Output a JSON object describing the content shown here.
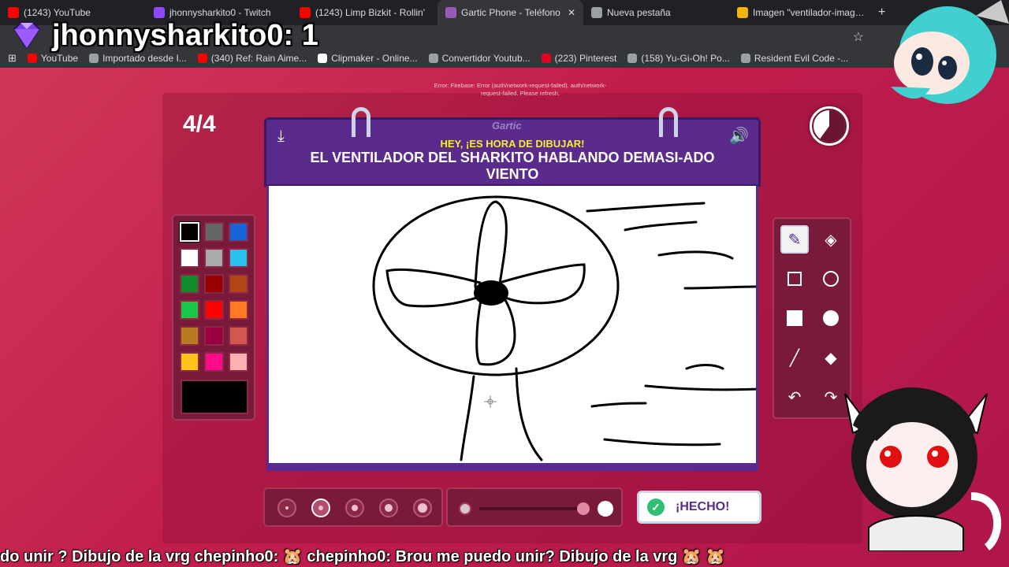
{
  "browser": {
    "tabs": [
      {
        "title": "(1243) YouTube",
        "favicon_color": "#ff0000",
        "active": false
      },
      {
        "title": "jhonnysharkito0 - Twitch",
        "favicon_color": "#9146ff",
        "active": false
      },
      {
        "title": "(1243) Limp Bizkit - Rollin'",
        "favicon_color": "#ff0000",
        "active": false
      },
      {
        "title": "Gartic Phone - Teléfono",
        "favicon_color": "#9b59b6",
        "active": true
      },
      {
        "title": "Nueva pestaña",
        "favicon_color": "#9aa0a6",
        "active": false
      },
      {
        "title": "Imagen \"ventilador-imagen-a",
        "favicon_color": "#f4b400",
        "active": false
      }
    ],
    "new_tab_label": "+",
    "close_label": "✕",
    "bookmarks": [
      {
        "label": "YouTube",
        "favicon_color": "#ff0000"
      },
      {
        "label": "Importado desde I...",
        "favicon_color": "#9aa0a6"
      },
      {
        "label": "(340) Ref: Rain Aime...",
        "favicon_color": "#ff0000"
      },
      {
        "label": "Clipmaker - Online...",
        "favicon_color": "#ffffff"
      },
      {
        "label": "Convertidor Youtub...",
        "favicon_color": "#9aa0a6"
      },
      {
        "label": "(223) Pinterest",
        "favicon_color": "#e60023"
      },
      {
        "label": "(158) Yu-Gi-Oh! Po...",
        "favicon_color": "#9aa0a6"
      },
      {
        "label": "Resident Evil Code -...",
        "favicon_color": "#9aa0a6"
      }
    ]
  },
  "overlay": {
    "score_text": "jhonnysharkito0: 1",
    "ticker_text": "do unir ? Dibujo de la vrg chepinho0: 🐹 chepinho0: Brou me puedo unir? Dibujo de la vrg 🐹 🐹"
  },
  "game": {
    "error_text": "Error: Firebase: Error (auth/network-request-failed). auth/network-request-failed. Please refresh.",
    "round": "4/4",
    "logo": "Gartic",
    "subtitle": "HEY, ¡ES HORA DE DIBUJAR!",
    "prompt": "EL VENTILADOR DEL SHARKITO HABLANDO DEMASI-ADO VIENTO",
    "done_label": "¡HECHO!",
    "timer_progress": 0.6,
    "palette": [
      "#000000",
      "#666666",
      "#1565d8",
      "#ffffff",
      "#aaaaaa",
      "#29c2f0",
      "#118a2c",
      "#990000",
      "#b04714",
      "#18c74a",
      "#ff0000",
      "#ff7a22",
      "#b77a20",
      "#990040",
      "#d2584f",
      "#ffc21a",
      "#ff0a89",
      "#ffb1b1"
    ],
    "selected_color": "#000000",
    "brush_sizes": [
      1,
      2,
      3,
      4,
      5
    ],
    "selected_brush_size": 2,
    "opacity": 1.0
  },
  "icons": {
    "download": "download-icon",
    "speaker": "speaker-icon",
    "pencil": "pencil-icon",
    "eraser": "eraser-icon",
    "check": "check-icon"
  }
}
